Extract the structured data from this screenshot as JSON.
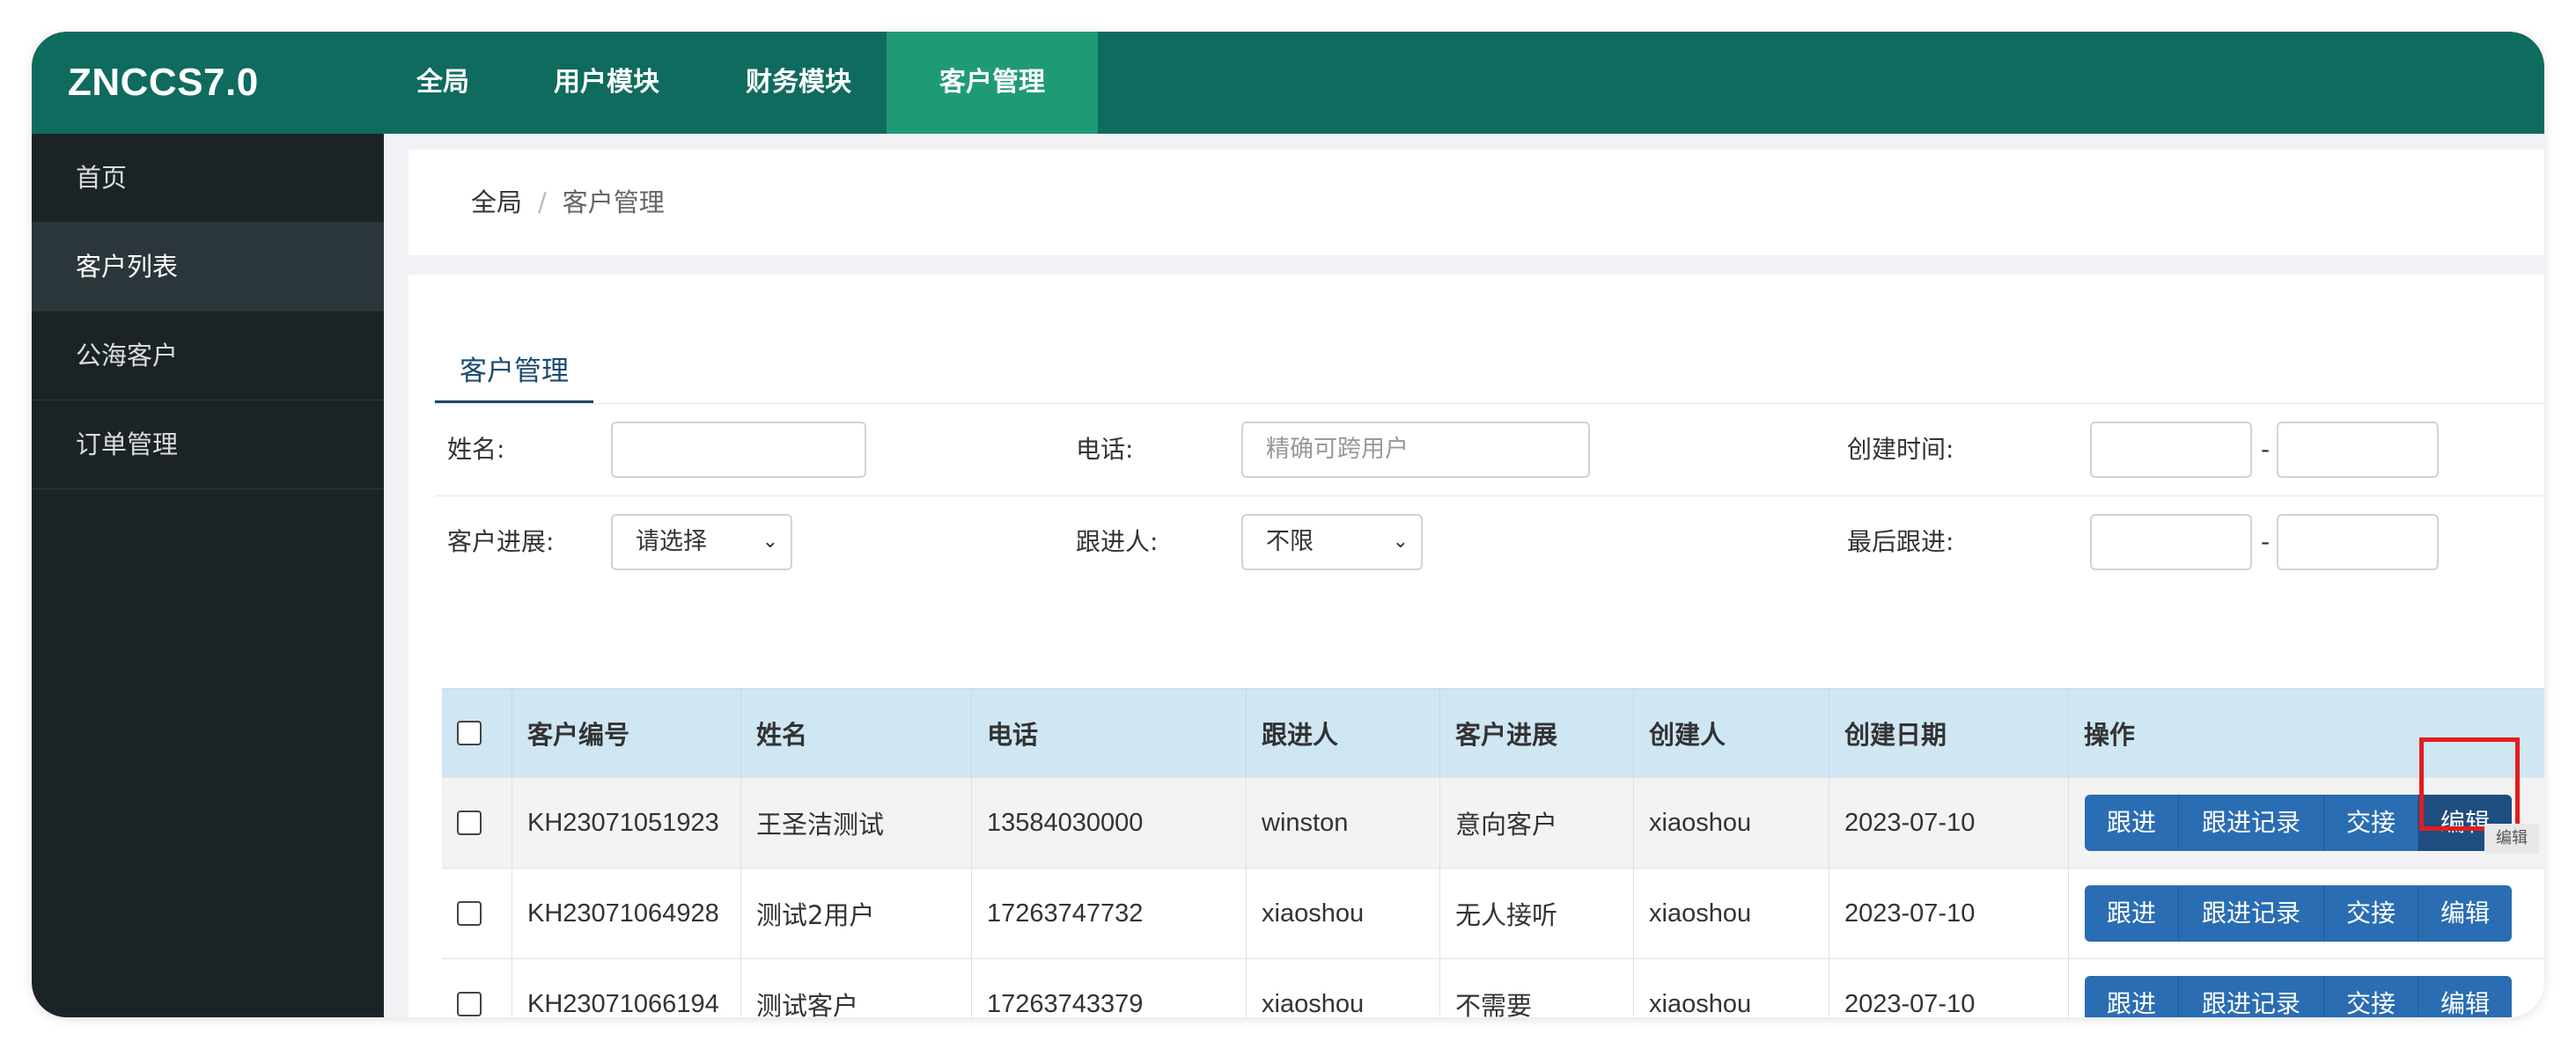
{
  "app": {
    "brand": "ZNCCS7.0"
  },
  "topnav": [
    {
      "label": "全局"
    },
    {
      "label": "用户模块"
    },
    {
      "label": "财务模块"
    },
    {
      "label": "客户管理",
      "active": true
    }
  ],
  "sidebar": [
    {
      "label": "首页"
    },
    {
      "label": "客户列表",
      "active": true
    },
    {
      "label": "公海客户"
    },
    {
      "label": "订单管理"
    }
  ],
  "breadcrumb": {
    "root": "全局",
    "separator": "/",
    "current": "客户管理"
  },
  "tab": {
    "label": "客户管理"
  },
  "filters": {
    "name_label": "姓名:",
    "phone_label": "电话:",
    "phone_placeholder": "精确可跨用户",
    "created_label": "创建时间:",
    "progress_label": "客户进展:",
    "progress_value": "请选择",
    "follower_label": "跟进人:",
    "follower_value": "不限",
    "last_follow_label": "最后跟进:",
    "range_dash": "-"
  },
  "table": {
    "headers": [
      "客户编号",
      "姓名",
      "电话",
      "跟进人",
      "客户进展",
      "创建人",
      "创建日期",
      "操作"
    ],
    "rows": [
      {
        "id": "KH23071051923",
        "name": "王圣洁测试",
        "phone": "13584030000",
        "follower": "winston",
        "progress": "意向客户",
        "creator": "xiaoshou",
        "date": "2023-07-10"
      },
      {
        "id": "KH23071064928",
        "name": "测试2用户",
        "phone": "17263747732",
        "follower": "xiaoshou",
        "progress": "无人接听",
        "creator": "xiaoshou",
        "date": "2023-07-10"
      },
      {
        "id": "KH23071066194",
        "name": "测试客户",
        "phone": "17263743379",
        "follower": "xiaoshou",
        "progress": "不需要",
        "creator": "xiaoshou",
        "date": "2023-07-10"
      }
    ],
    "actions": [
      "跟进",
      "跟进记录",
      "交接",
      "编辑"
    ]
  },
  "tooltip": "编辑",
  "colors": {
    "header": "#0f6b5e",
    "active_nav": "#1f9a77",
    "sidebar": "#1c2326",
    "button": "#2a6db2",
    "table_head": "#cfe6f3",
    "highlight": "#e21d1d"
  }
}
